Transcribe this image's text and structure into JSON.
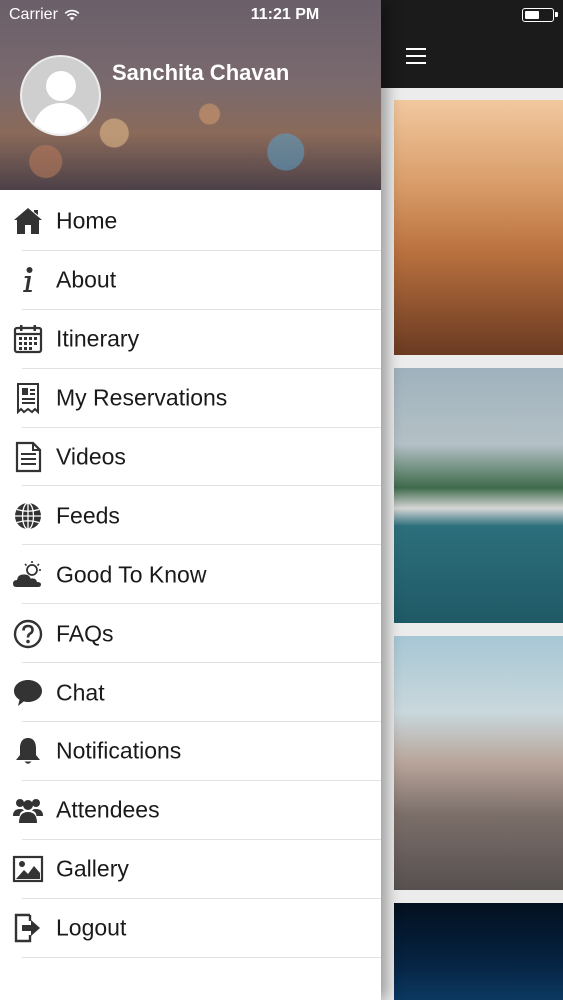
{
  "status_bar": {
    "carrier": "Carrier",
    "time": "11:21 PM"
  },
  "drawer": {
    "user_name": "Sanchita Chavan",
    "menu": [
      {
        "label": "Home",
        "icon": "home-icon"
      },
      {
        "label": "About",
        "icon": "info-icon"
      },
      {
        "label": "Itinerary",
        "icon": "calendar-icon"
      },
      {
        "label": "My Reservations",
        "icon": "receipt-icon"
      },
      {
        "label": "Videos",
        "icon": "document-icon"
      },
      {
        "label": "Feeds",
        "icon": "globe-icon"
      },
      {
        "label": "Good To Know",
        "icon": "weather-icon"
      },
      {
        "label": "FAQs",
        "icon": "question-icon"
      },
      {
        "label": "Chat",
        "icon": "chat-bubble-icon"
      },
      {
        "label": "Notifications",
        "icon": "bell-icon"
      },
      {
        "label": "Attendees",
        "icon": "people-icon"
      },
      {
        "label": "Gallery",
        "icon": "picture-icon"
      },
      {
        "label": "Logout",
        "icon": "logout-icon"
      }
    ]
  },
  "main": {
    "menu_icon": "hamburger-icon",
    "gallery": [
      "card-1",
      "card-2",
      "card-3",
      "card-4"
    ]
  },
  "colors": {
    "topbar": "#1b1b1b",
    "menu_text": "#1a1a1a",
    "divider": "#e2e2e2",
    "icon": "#333333"
  }
}
